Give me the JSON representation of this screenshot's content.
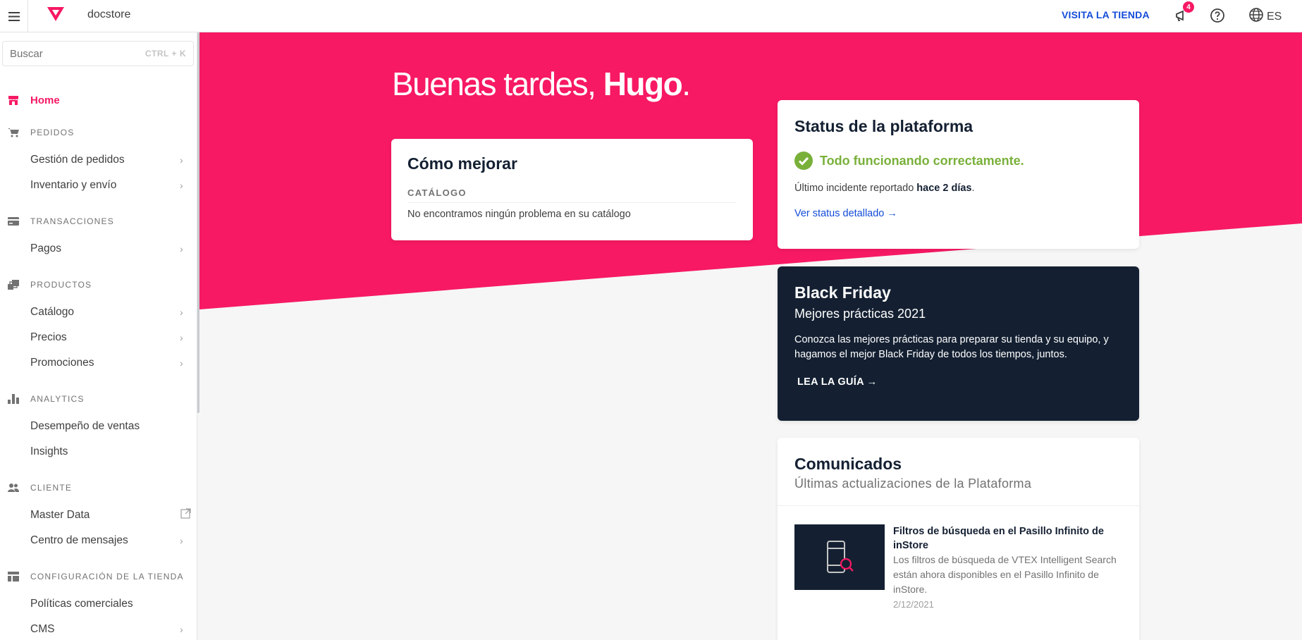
{
  "topbar": {
    "store_name": "docstore",
    "visit_store": "VISITA LA TIENDA",
    "notifications_count": "4",
    "language": "ES"
  },
  "sidebar": {
    "search_placeholder": "Buscar",
    "search_shortcut": "CTRL + K",
    "home": "Home",
    "sections": {
      "pedidos": "PEDIDOS",
      "transacciones": "TRANSACCIONES",
      "productos": "PRODUCTOS",
      "analytics": "ANALYTICS",
      "cliente": "CLIENTE",
      "config": "CONFIGURACIÓN DE LA TIENDA"
    },
    "items": {
      "gestion_pedidos": "Gestión de pedidos",
      "inventario": "Inventario y envío",
      "pagos": "Pagos",
      "catalogo": "Catálogo",
      "precios": "Precios",
      "promociones": "Promociones",
      "desempeno": "Desempeño de ventas",
      "insights": "Insights",
      "master_data": "Master Data",
      "centro_mensajes": "Centro de mensajes",
      "politicas": "Políticas comerciales",
      "cms": "CMS"
    }
  },
  "main": {
    "greeting_prefix": "Buenas tardes, ",
    "greeting_name": "Hugo",
    "greeting_suffix": ".",
    "improve": {
      "title": "Cómo mejorar",
      "category": "CATÁLOGO",
      "message": "No encontramos ningún problema en su catálogo"
    },
    "status": {
      "title": "Status de la plataforma",
      "ok": "Todo funcionando correctamente.",
      "last_prefix": "Último incidente reportado ",
      "last_bold": "hace 2 días",
      "last_suffix": ".",
      "link": "Ver status detallado →"
    },
    "black_friday": {
      "title": "Black Friday",
      "subtitle": "Mejores prácticas 2021",
      "description": "Conozca las mejores prácticas para preparar su tienda y su equipo, y hagamos el mejor Black Friday de todos los tiempos, juntos.",
      "cta": "LEA LA GUÍA →"
    },
    "comms": {
      "title": "Comunicados",
      "subtitle": "Últimas actualizaciones de la Plataforma",
      "entries": [
        {
          "title": "Filtros de búsqueda en el Pasillo Infinito de inStore",
          "description": "Los filtros de búsqueda de VTEX Intelligent Search están ahora disponibles en el Pasillo Infinito de inStore.",
          "date": "2/12/2021"
        }
      ]
    }
  },
  "colors": {
    "brand_pink": "#f71963",
    "navy": "#142032",
    "link_blue": "#134cd8",
    "success_green": "#79b03a"
  }
}
